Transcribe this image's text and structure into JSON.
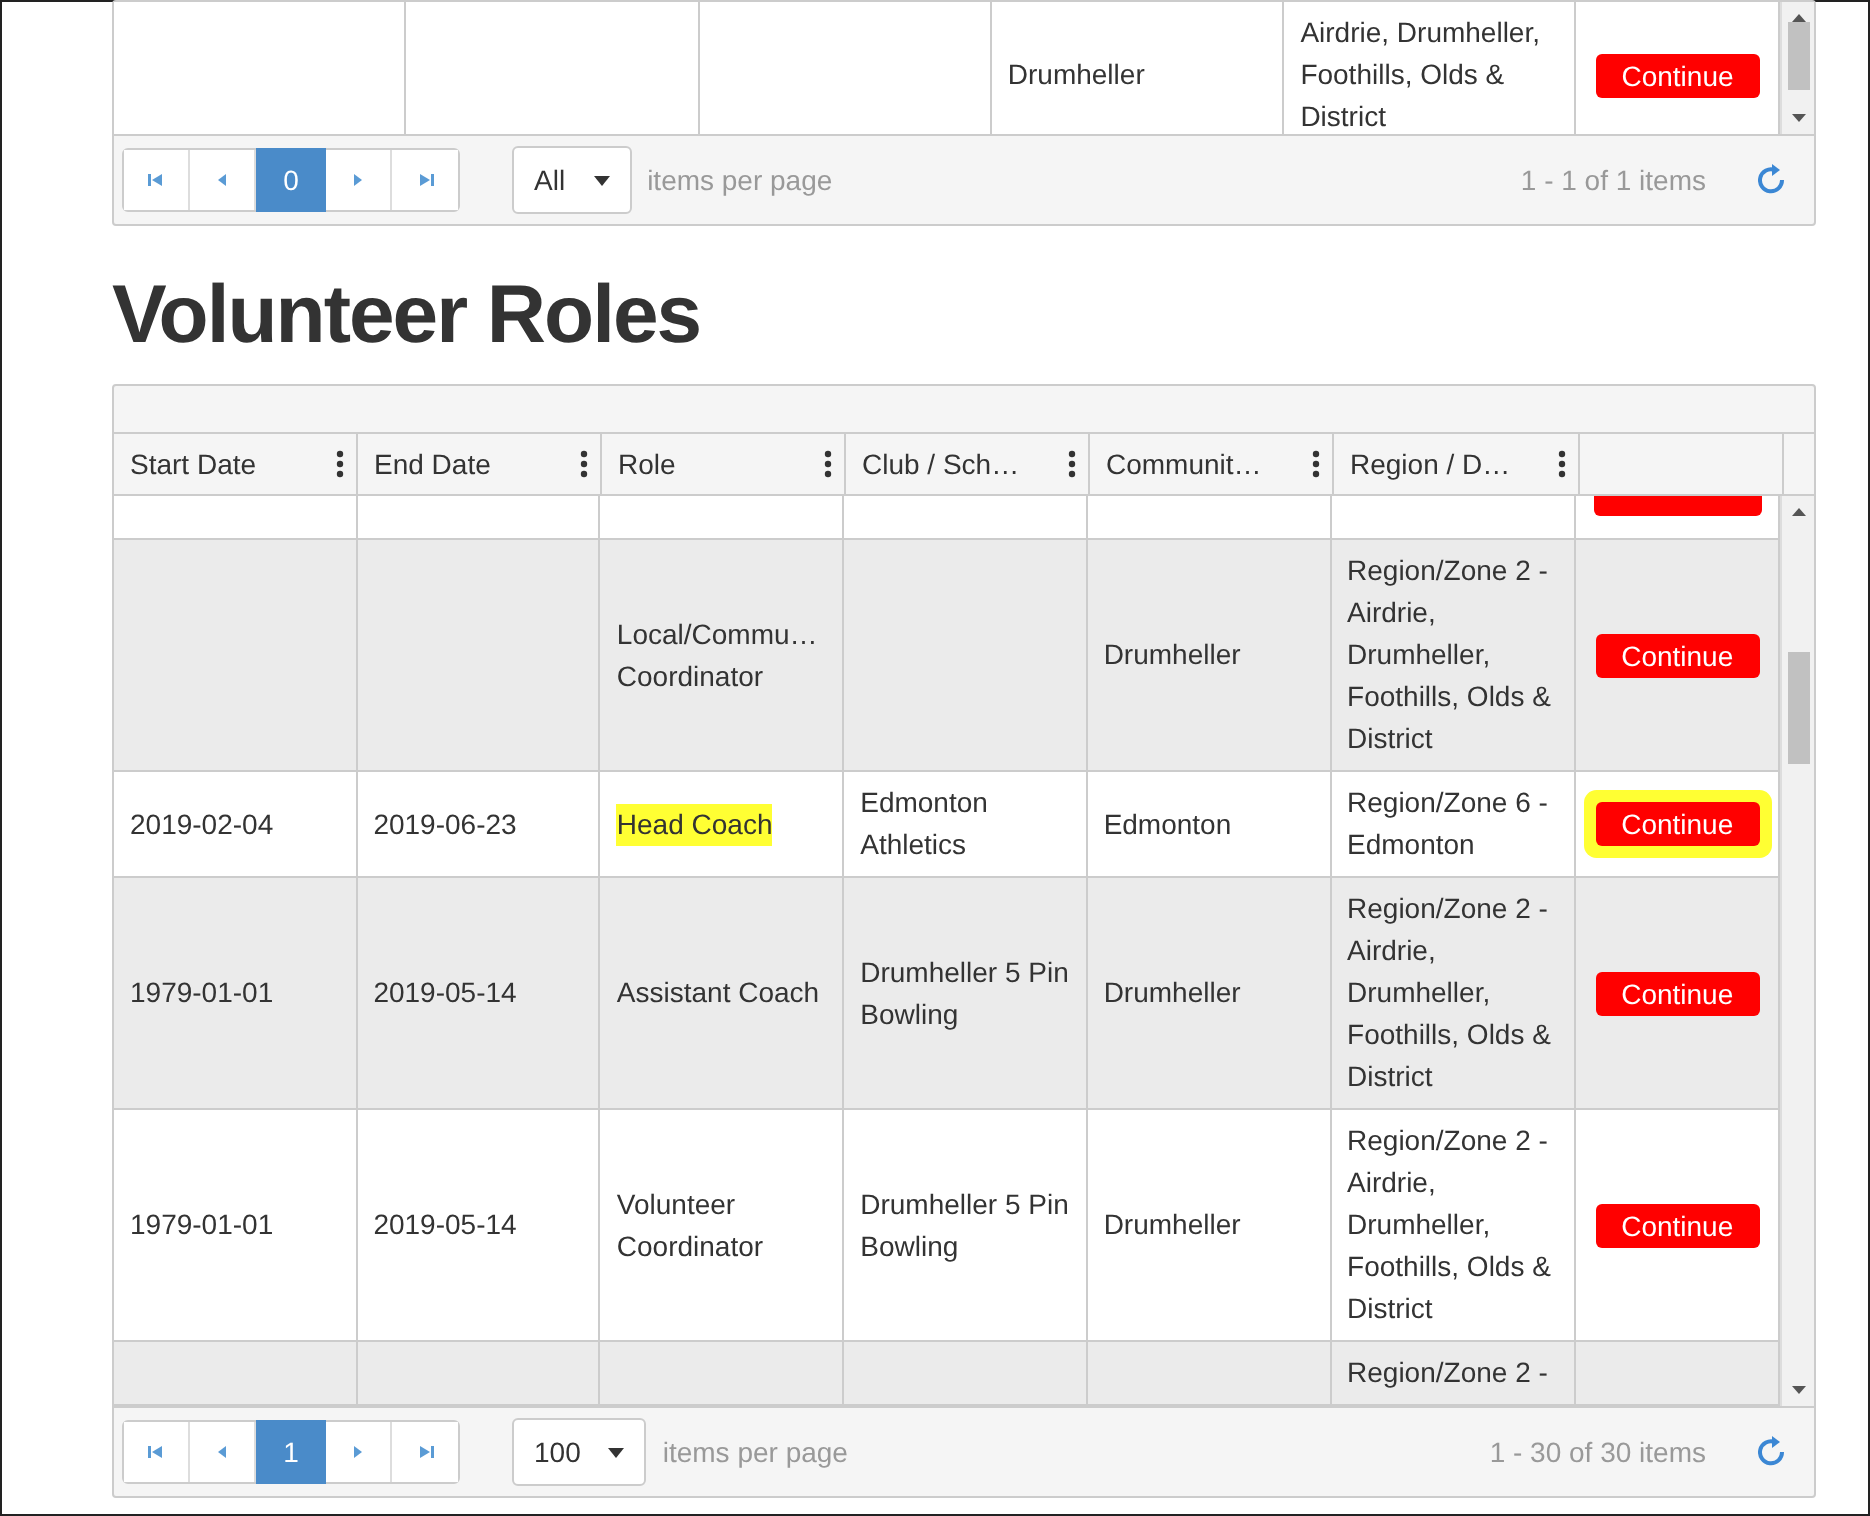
{
  "top_grid": {
    "rows": [
      {
        "cells": [
          "",
          "",
          "",
          "Drumheller",
          "Airdrie, Drumheller, Foothills, Olds & District"
        ],
        "button": true,
        "action": "Continue",
        "highlighted": false
      }
    ],
    "pager": {
      "pages": [
        {
          "label": "0",
          "selected": true
        }
      ],
      "page_size": "All",
      "page_size_label": "items per page",
      "info": "1 - 1 of 1 items"
    }
  },
  "heading": "Volunteer Roles",
  "roles_grid": {
    "columns": [
      "Start Date",
      "End Date",
      "Role",
      "Club / Sch…",
      "Communit…",
      "Region / D…"
    ],
    "rows": [
      {
        "cells": [
          "",
          "",
          "",
          "",
          "",
          ""
        ],
        "button": true,
        "highlighted": false
      },
      {
        "cells": [
          "",
          "",
          "Local/Commu… Coordinator",
          "",
          "Drumheller",
          "Region/Zone 2 - Airdrie, Drumheller, Foothills, Olds & District"
        ],
        "button": true,
        "action": "Continue",
        "highlighted": false
      },
      {
        "cells": [
          "2019-02-04",
          "2019-06-23",
          "Head Coach",
          "Edmonton Athletics",
          "Edmonton",
          "Region/Zone 6 - Edmonton"
        ],
        "button": true,
        "action": "Continue",
        "highlighted": true
      },
      {
        "cells": [
          "1979-01-01",
          "2019-05-14",
          "Assistant Coach",
          "Drumheller 5 Pin Bowling",
          "Drumheller",
          "Region/Zone 2 - Airdrie, Drumheller, Foothills, Olds & District"
        ],
        "button": true,
        "action": "Continue",
        "highlighted": false
      },
      {
        "cells": [
          "1979-01-01",
          "2019-05-14",
          "Volunteer Coordinator",
          "Drumheller 5 Pin Bowling",
          "Drumheller",
          "Region/Zone 2 - Airdrie, Drumheller, Foothills, Olds & District"
        ],
        "button": true,
        "action": "Continue",
        "highlighted": false
      },
      {
        "cells": [
          "",
          "",
          "",
          "",
          "",
          "Region/Zone 2 -"
        ],
        "button": false,
        "highlighted": false
      }
    ],
    "pager": {
      "pages": [
        {
          "label": "1",
          "selected": true
        }
      ],
      "page_size": "100",
      "page_size_label": "items per page",
      "info": "1 - 30 of 30 items"
    }
  }
}
